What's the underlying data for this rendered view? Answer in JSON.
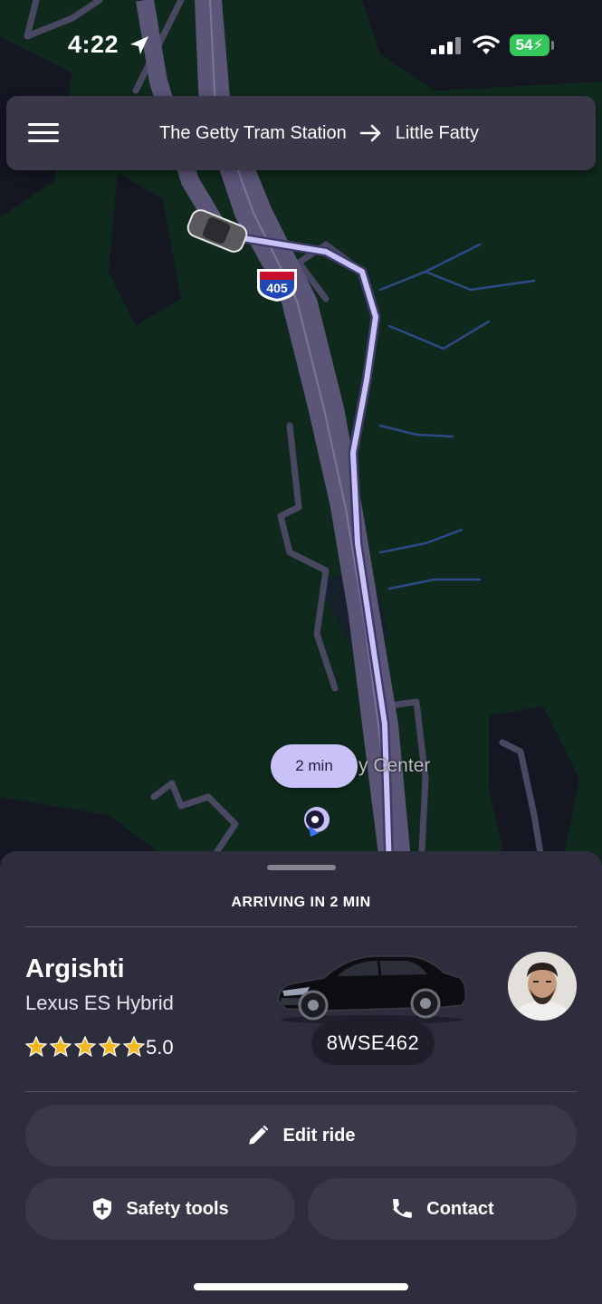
{
  "status_bar": {
    "time": "4:22",
    "battery": "54",
    "location_icon": "location-arrow-icon",
    "signal_icon": "cellular-signal-icon",
    "wifi_icon": "wifi-icon"
  },
  "route": {
    "menu_icon": "hamburger-menu-icon",
    "origin": "The Getty Tram Station",
    "destination": "Little Fatty",
    "arrow_icon": "arrow-right-icon"
  },
  "map": {
    "eta_pill": "2 min",
    "place_label": "y Center",
    "highway_shield": "405",
    "colors": {
      "land": "#0f2a1c",
      "road": "#5b5578",
      "route_line": "#c8c2f8",
      "water": "#2c4a86"
    }
  },
  "ride": {
    "status": "ARRIVING IN 2 MIN",
    "driver_name": "Argishti",
    "car_model": "Lexus ES Hybrid",
    "rating": "5.0",
    "rating_stars": 5,
    "plate": "8WSE462",
    "star_color": "#f5b820"
  },
  "actions": {
    "edit_label": "Edit ride",
    "safety_label": "Safety tools",
    "contact_label": "Contact",
    "edit_icon": "pencil-icon",
    "safety_icon": "shield-plus-icon",
    "contact_icon": "phone-icon"
  }
}
